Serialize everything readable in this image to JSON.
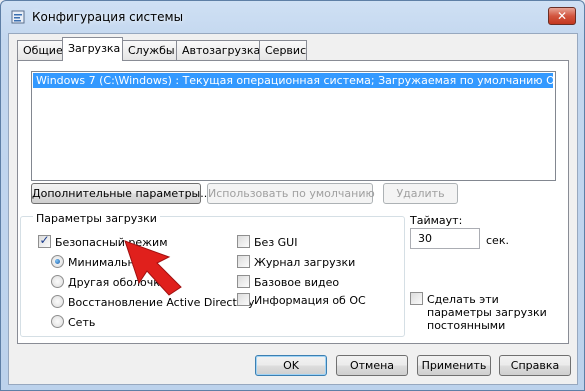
{
  "window": {
    "title": "Конфигурация системы",
    "close_glyph": "✕"
  },
  "tabs": [
    {
      "label": "Общие",
      "active": false
    },
    {
      "label": "Загрузка",
      "active": true
    },
    {
      "label": "Службы",
      "active": false
    },
    {
      "label": "Автозагрузка",
      "active": false
    },
    {
      "label": "Сервис",
      "active": false
    }
  ],
  "os_list": {
    "items": [
      "Windows 7 (C:\\Windows) : Текущая операционная система; Загружаемая по умолчанию ОС"
    ],
    "selected_index": 0
  },
  "list_buttons": {
    "advanced": "Дополнительные параметры...",
    "set_default": "Использовать по умолчанию",
    "delete": "Удалить"
  },
  "boot_options": {
    "title": "Параметры загрузки",
    "safe_boot": {
      "label": "Безопасный режим",
      "checked": true
    },
    "radios": [
      {
        "label": "Минимальная",
        "selected": true
      },
      {
        "label": "Другая оболочка",
        "selected": false
      },
      {
        "label": "Восстановление Active Directory",
        "selected": false
      },
      {
        "label": "Сеть",
        "selected": false
      }
    ],
    "checks": [
      {
        "label": "Без GUI",
        "checked": false
      },
      {
        "label": "Журнал загрузки",
        "checked": false
      },
      {
        "label": "Базовое видео",
        "checked": false
      },
      {
        "label": "Информация  об ОС",
        "checked": false
      }
    ]
  },
  "timeout": {
    "label": "Таймаут:",
    "value": "30",
    "unit": "сек."
  },
  "make_permanent": {
    "label": "Сделать эти параметры загрузки постоянными",
    "checked": false
  },
  "dialog_buttons": {
    "ok": "OK",
    "cancel": "Отмена",
    "apply": "Применить",
    "help": "Справка"
  },
  "colors": {
    "selection": "#3399ff",
    "annotation_arrow": "#e0201c"
  }
}
